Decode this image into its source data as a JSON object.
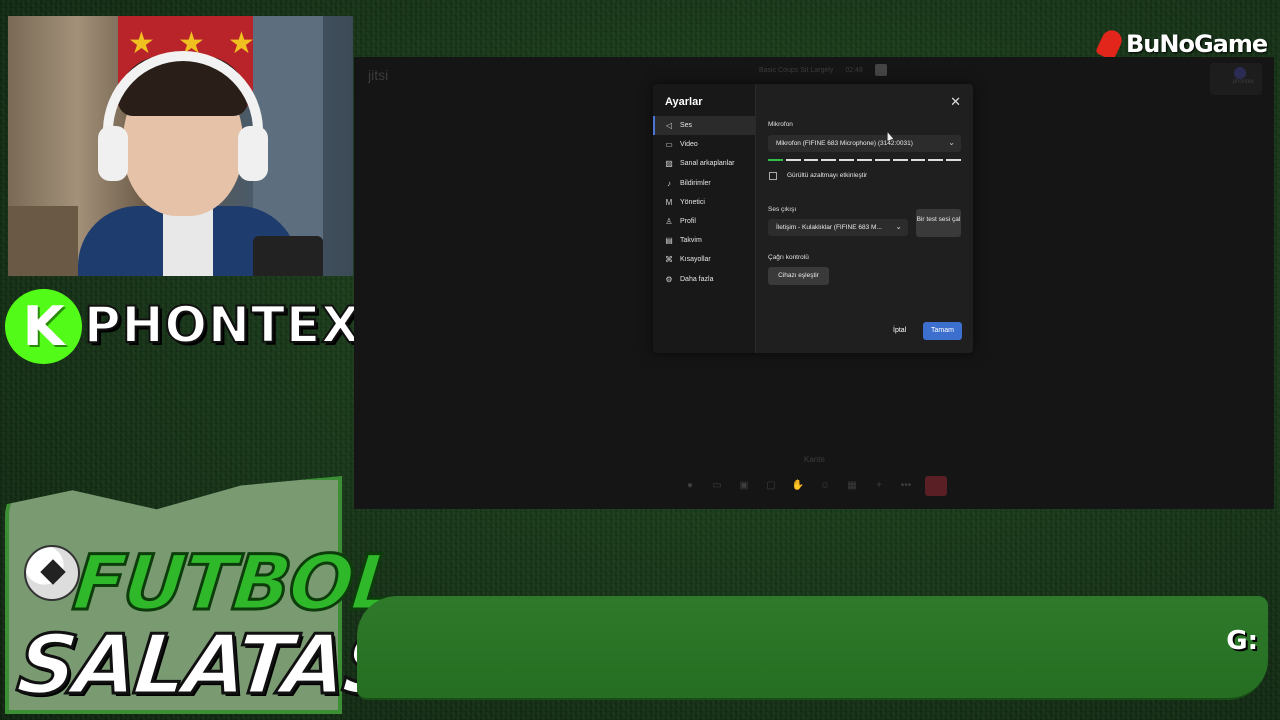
{
  "overlay": {
    "channel_name": "PHONTEX",
    "kick_letter": "K",
    "show_title_line1": "FUTBOL",
    "show_title_line2": "SALATASI",
    "brand": "BuNoGame",
    "ticker_text": "G:"
  },
  "jitsi": {
    "logo": "jitsi",
    "meeting_title": "Basic Coups Sit Largely",
    "timer": "02:48",
    "participant_tile_name": "phontex",
    "participant_name": "Kante"
  },
  "settings": {
    "title": "Ayarlar",
    "nav": [
      {
        "label": "Ses",
        "icon": "speaker-icon"
      },
      {
        "label": "Video",
        "icon": "video-icon"
      },
      {
        "label": "Sanal arkaplanlar",
        "icon": "image-icon"
      },
      {
        "label": "Bildirimler",
        "icon": "bell-icon"
      },
      {
        "label": "Yönetici",
        "icon": "moderator-icon"
      },
      {
        "label": "Profil",
        "icon": "user-icon"
      },
      {
        "label": "Takvim",
        "icon": "calendar-icon"
      },
      {
        "label": "Kısayollar",
        "icon": "shortcuts-icon"
      },
      {
        "label": "Daha fazla",
        "icon": "gear-icon"
      }
    ],
    "active_nav": "Ses",
    "microphone_label": "Mikrofon",
    "microphone_value": "Mikrofon (FIFINE 683 Microphone) (3142:0031)",
    "mic_level_fraction": 0.09,
    "noise_suppression_label": "Gürültü azaltmayı etkinleştir",
    "noise_suppression_checked": false,
    "audio_output_label": "Ses çıkışı",
    "audio_output_value": "İletişim - Kulaklıklar (FIFINE 683 M...",
    "test_sound_button": "Bir test sesi çal",
    "call_control_label": "Çağrı kontrolü",
    "pair_device_button": "Cihazı eşleştir",
    "cancel_button": "İptal",
    "ok_button": "Tamam",
    "accent_color": "#3d6fcf"
  }
}
